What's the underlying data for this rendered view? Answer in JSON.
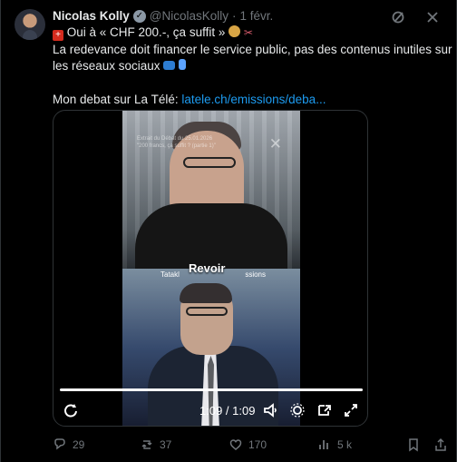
{
  "post": {
    "author": "Nicolas Kolly",
    "handle": "@NicolasKolly",
    "separator": "·",
    "date": "1 févr.",
    "line1": "Oui à « CHF 200.-, ça suffit »",
    "line2": "La redevance doit financer le service public, pas des contenus inutiles sur",
    "line3": "les réseaux sociaux",
    "debate_prefix": "Mon debat sur La Télé:",
    "link": "latele.ch/emissions/deba..."
  },
  "video": {
    "overlay_text": "Extrait du Débat du 25.01.2026\n\"200 francs, ça suffit ? (partie 1)\"",
    "caption_left": "Tatakl",
    "caption_right": "ssions",
    "replay_label": "Revoir",
    "time": "1:09 / 1:09",
    "progress": 1
  },
  "actions": {
    "replies": "29",
    "reposts": "37",
    "likes": "170",
    "views": "5 k"
  },
  "icons": {
    "grok": "grok-icon",
    "more": "more-icon",
    "replay": "replay-icon",
    "volume": "volume-icon",
    "settings": "settings-icon",
    "picture_in_picture": "picture-in-picture-icon",
    "fullscreen": "fullscreen-icon",
    "reply": "reply-icon",
    "repost": "repost-icon",
    "like": "heart-icon",
    "views": "views-icon",
    "bookmark": "bookmark-icon",
    "share": "share-icon"
  },
  "colors": {
    "background": "#000000",
    "text": "#e7e9ea",
    "muted": "#71767b",
    "link": "#1d9bf0",
    "divider": "#2f3336"
  }
}
